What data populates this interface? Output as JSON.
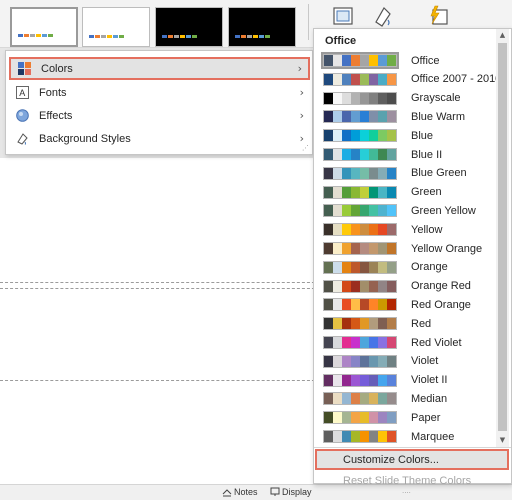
{
  "menu": {
    "items": [
      {
        "label": "Colors",
        "icon": "colors-icon",
        "active": true
      },
      {
        "label": "Fonts",
        "icon": "fonts-icon",
        "active": false
      },
      {
        "label": "Effects",
        "icon": "effects-icon",
        "active": false
      },
      {
        "label": "Background Styles",
        "icon": "background-styles-icon",
        "active": false
      }
    ],
    "chevron": "›",
    "grip": "⋰"
  },
  "colors_panel": {
    "header": "Office",
    "palettes": [
      {
        "name": "Office",
        "colors": [
          "#44546a",
          "#e7e6e6",
          "#4472c4",
          "#ed7d31",
          "#a5a5a5",
          "#ffc000",
          "#5b9bd5",
          "#70ad47"
        ]
      },
      {
        "name": "Office 2007 - 2010",
        "colors": [
          "#1f497d",
          "#eeece1",
          "#4f81bd",
          "#c0504d",
          "#9bbb59",
          "#8064a2",
          "#4bacc6",
          "#f79646"
        ]
      },
      {
        "name": "Grayscale",
        "colors": [
          "#000000",
          "#f8f8f8",
          "#dddddd",
          "#b2b2b2",
          "#969696",
          "#808080",
          "#5f5f5f",
          "#4d4d4d"
        ]
      },
      {
        "name": "Blue Warm",
        "colors": [
          "#242852",
          "#acccea",
          "#4a66ac",
          "#629dd1",
          "#297fd5",
          "#7f8fa9",
          "#5aa2ae",
          "#9d90a0"
        ]
      },
      {
        "name": "Blue",
        "colors": [
          "#17406d",
          "#dbeff9",
          "#0f6fc6",
          "#009dd9",
          "#0bd0d9",
          "#10cf9b",
          "#7cca62",
          "#a5c249"
        ]
      },
      {
        "name": "Blue II",
        "colors": [
          "#335b74",
          "#dfe3e5",
          "#1cade4",
          "#2683c6",
          "#27ced7",
          "#42ba97",
          "#3e8853",
          "#62a39f"
        ]
      },
      {
        "name": "Blue Green",
        "colors": [
          "#373545",
          "#cedbe6",
          "#3494ba",
          "#58b6c0",
          "#75bda7",
          "#7a8c8e",
          "#84acb6",
          "#2683c6"
        ]
      },
      {
        "name": "Green",
        "colors": [
          "#455f51",
          "#e3ded1",
          "#549e39",
          "#8ab833",
          "#c0cf3a",
          "#029676",
          "#4ab5c4",
          "#0989b1"
        ]
      },
      {
        "name": "Green Yellow",
        "colors": [
          "#455f51",
          "#e3ded1",
          "#99cb38",
          "#63a537",
          "#37a76f",
          "#44c1a3",
          "#4eb3cf",
          "#51c3f9"
        ]
      },
      {
        "name": "Yellow",
        "colors": [
          "#39302a",
          "#e5dec3",
          "#ffca08",
          "#f8931d",
          "#ce8d3e",
          "#ec7016",
          "#e64823",
          "#9c6a6a"
        ]
      },
      {
        "name": "Yellow Orange",
        "colors": [
          "#4e3b30",
          "#fbeec9",
          "#f0a22e",
          "#a5644e",
          "#b58b80",
          "#c3986d",
          "#a19574",
          "#c17529"
        ]
      },
      {
        "name": "Orange",
        "colors": [
          "#637052",
          "#ccddea",
          "#e48312",
          "#bd582c",
          "#865640",
          "#9b8357",
          "#c2bc80",
          "#94a088"
        ]
      },
      {
        "name": "Orange Red",
        "colors": [
          "#505046",
          "#eeece1",
          "#d34817",
          "#9b2d1f",
          "#a28e6a",
          "#956251",
          "#918485",
          "#855d5d"
        ]
      },
      {
        "name": "Red Orange",
        "colors": [
          "#505046",
          "#e8e8e8",
          "#e84c22",
          "#ffbd47",
          "#b64926",
          "#ff8427",
          "#cc9900",
          "#b22600"
        ]
      },
      {
        "name": "Red",
        "colors": [
          "#323232",
          "#e5c243",
          "#a5300f",
          "#d55816",
          "#e19825",
          "#b19c7d",
          "#7f5f52",
          "#b27d49"
        ]
      },
      {
        "name": "Red Violet",
        "colors": [
          "#454551",
          "#d8d9dc",
          "#e32d91",
          "#c830cc",
          "#4ea6dc",
          "#4775e7",
          "#8971e1",
          "#d54773"
        ]
      },
      {
        "name": "Violet",
        "colors": [
          "#373545",
          "#dcd8dc",
          "#ad84c6",
          "#8784c7",
          "#5d739a",
          "#6997af",
          "#84acb6",
          "#6f8183"
        ]
      },
      {
        "name": "Violet II",
        "colors": [
          "#632e62",
          "#eae5eb",
          "#92278f",
          "#9b57d3",
          "#755dd9",
          "#665eb8",
          "#45a5ed",
          "#5982db"
        ]
      },
      {
        "name": "Median",
        "colors": [
          "#775f55",
          "#ebddc3",
          "#94b6d2",
          "#dd8047",
          "#a5ab81",
          "#d8b25c",
          "#7ba79d",
          "#968c8c"
        ]
      },
      {
        "name": "Paper",
        "colors": [
          "#444d26",
          "#fefac9",
          "#a5b592",
          "#f3a447",
          "#e7bc29",
          "#d092a7",
          "#9c85c0",
          "#809ec2"
        ]
      },
      {
        "name": "Marquee",
        "colors": [
          "#5e5e5e",
          "#ddddde",
          "#418ab3",
          "#a6b727",
          "#f69200",
          "#838383",
          "#fec306",
          "#df5327"
        ]
      }
    ],
    "customize_label": "Customize Colors...",
    "reset_label": "Reset Slide Theme Colors",
    "dots": "....",
    "scroll_up": "▲",
    "scroll_down": "▼"
  },
  "status_bar": {
    "notes_label": "Notes",
    "display_label": "Display"
  },
  "theme_thumbnails": [
    {
      "bg": "#ffffff",
      "colors": [
        "#4472c4",
        "#ed7d31",
        "#a5a5a5",
        "#ffc000",
        "#5b9bd5",
        "#70ad47"
      ]
    },
    {
      "bg": "#ffffff",
      "colors": [
        "#4472c4",
        "#ed7d31",
        "#a5a5a5",
        "#ffc000",
        "#5b9bd5",
        "#70ad47"
      ]
    },
    {
      "bg": "#000000",
      "colors": [
        "#4472c4",
        "#ed7d31",
        "#a5a5a5",
        "#ffc000",
        "#5b9bd5",
        "#70ad47"
      ]
    },
    {
      "bg": "#000000",
      "colors": [
        "#4472c4",
        "#ed7d31",
        "#a5a5a5",
        "#ffc000",
        "#5b9bd5",
        "#70ad47"
      ]
    }
  ],
  "accent_color": "#e46f5e"
}
